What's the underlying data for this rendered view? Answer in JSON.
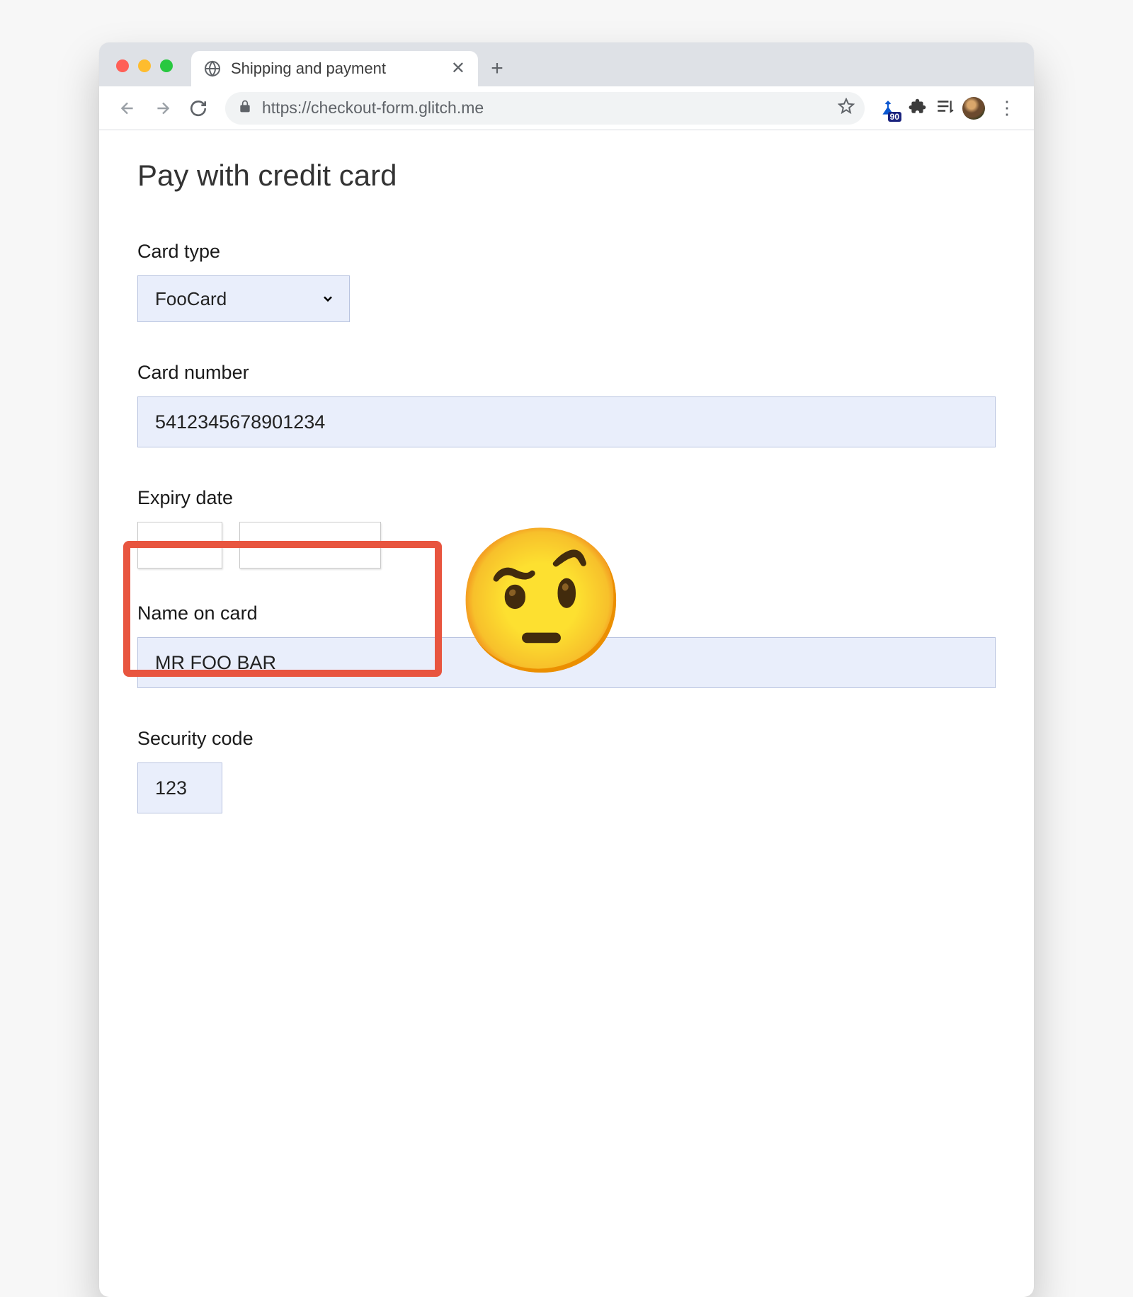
{
  "browser": {
    "tab_title": "Shipping and payment",
    "url": "https://checkout-form.glitch.me",
    "ext_badge": "90"
  },
  "page": {
    "title": "Pay with credit card"
  },
  "form": {
    "card_type": {
      "label": "Card type",
      "value": "FooCard"
    },
    "card_number": {
      "label": "Card number",
      "value": "5412345678901234"
    },
    "expiry": {
      "label": "Expiry date",
      "month_value": "",
      "year_value": ""
    },
    "name_on_card": {
      "label": "Name on card",
      "value": "MR FOO BAR"
    },
    "security_code": {
      "label": "Security code",
      "value": "123"
    }
  },
  "annotation": {
    "emoji": "🤨"
  }
}
